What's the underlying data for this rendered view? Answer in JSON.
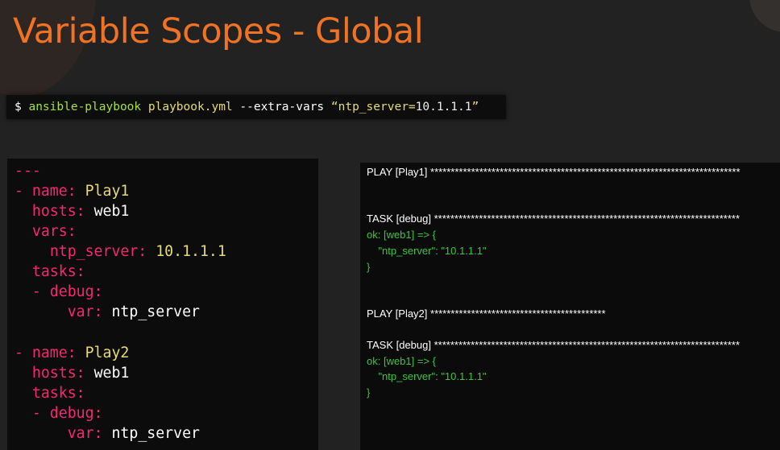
{
  "slide": {
    "title": "Variable Scopes - Global"
  },
  "command": {
    "prompt": "$",
    "program": "ansible-playbook",
    "playbook": "playbook.yml",
    "flag": "--extra-vars",
    "arg_open": "“ntp_server=",
    "arg_value": "10.1.1.1",
    "arg_close": "”"
  },
  "playbook": {
    "doc_start": "---",
    "plays": [
      {
        "name_key": "- name:",
        "name": "Play1",
        "hosts_key": "hosts:",
        "hosts": "web1",
        "vars_key": "vars:",
        "var_key": "ntp_server:",
        "var_value": "10.1.1.1",
        "tasks_key": "tasks:",
        "task_key": "- debug:",
        "task_arg_key": "var:",
        "task_arg_value": "ntp_server"
      },
      {
        "name_key": "- name:",
        "name": "Play2",
        "hosts_key": "hosts:",
        "hosts": "web1",
        "tasks_key": "tasks:",
        "task_key": "- debug:",
        "task_arg_key": "var:",
        "task_arg_value": "ntp_server"
      }
    ]
  },
  "output": {
    "lines": [
      {
        "text": "PLAY [Play1] ****************************************************************************",
        "color": "#ffffff"
      },
      {
        "text": "TASK [debug] ***************************************************************************",
        "color": "#ffffff"
      },
      {
        "text": "ok: [web1] => {",
        "color": "#3ec43e"
      },
      {
        "text": "    \"ntp_server\": \"10.1.1.1\"",
        "color": "#3ec43e"
      },
      {
        "text": "}",
        "color": "#3ec43e"
      },
      {
        "text": "PLAY [Play2] *******************************************",
        "color": "#ffffff"
      },
      {
        "text": "TASK [debug] ***************************************************************************",
        "color": "#ffffff"
      },
      {
        "text": "ok: [web1] => {",
        "color": "#3ec43e"
      },
      {
        "text": "    \"ntp_server\": \"10.1.1.1\"",
        "color": "#3ec43e"
      },
      {
        "text": "}",
        "color": "#3ec43e"
      }
    ]
  },
  "colors": {
    "title": "#f27224",
    "yaml_key": "#f92672",
    "yaml_value": "#e6db74",
    "output_ok": "#3ec43e",
    "output_header": "#ffffff"
  }
}
